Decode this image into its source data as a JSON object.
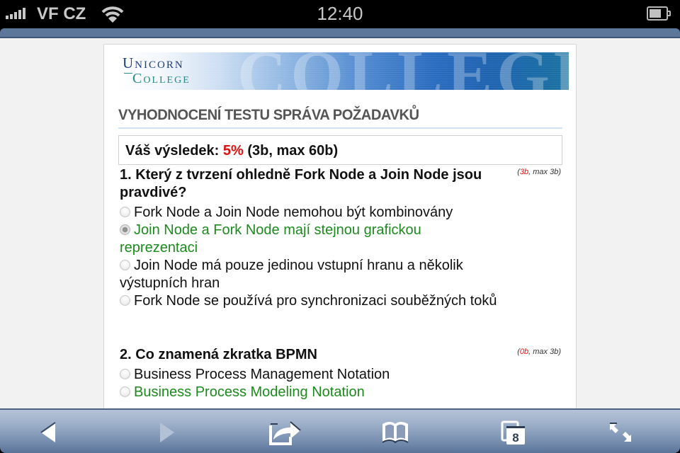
{
  "status_bar": {
    "carrier": "VF CZ",
    "time": "12:40",
    "signal_bars": 5,
    "battery_level_fraction": 0.6,
    "icons": [
      "signal-icon",
      "wifi-icon",
      "battery-icon"
    ]
  },
  "banner": {
    "logo_line1": "Unicorn",
    "logo_line2": "College",
    "background_word": "COLLEGE"
  },
  "page": {
    "title": "VYHODNOCENÍ TESTU SPRÁVA POŽADAVKŮ",
    "result": {
      "label": "Váš výsledek: ",
      "percent": "5%",
      "detail": " (3b, max 60b)"
    },
    "colors": {
      "correct": "#1d8a1d",
      "score_red": "#e01010",
      "title_gray": "#555555"
    },
    "questions": [
      {
        "text": "1. Který z tvrzení ohledně Fork Node a Join Node jsou pravdivé?",
        "score_open": "(",
        "score_got": "3b",
        "score_rest": ", max 3b)",
        "answers": [
          {
            "text": "Fork Node a Join Node nemohou být kombinovány",
            "correct": false,
            "checked": false
          },
          {
            "text": "Join Node a Fork Node mají stejnou grafickou reprezentaci",
            "correct": true,
            "checked": true
          },
          {
            "text": "Join Node má pouze jedinou vstupní hranu a několik výstupních hran",
            "correct": false,
            "checked": false
          },
          {
            "text": "Fork Node se používá pro synchronizaci souběžných toků",
            "correct": false,
            "checked": false
          }
        ]
      },
      {
        "text": "2. Co znamená zkratka BPMN",
        "score_open": "(",
        "score_got": "0b",
        "score_rest": ", max 3b)",
        "answers": [
          {
            "text": "Business Process Management Notation",
            "correct": false,
            "checked": false
          },
          {
            "text": "Business Process Modeling Notation",
            "correct": true,
            "checked": false
          }
        ]
      }
    ]
  },
  "toolbar": {
    "back": "back-icon",
    "forward": "forward-icon",
    "share": "share-icon",
    "bookmarks": "bookmarks-icon",
    "tabs": "tabs-icon",
    "tabs_count": "8",
    "fullscreen": "fullscreen-icon"
  }
}
